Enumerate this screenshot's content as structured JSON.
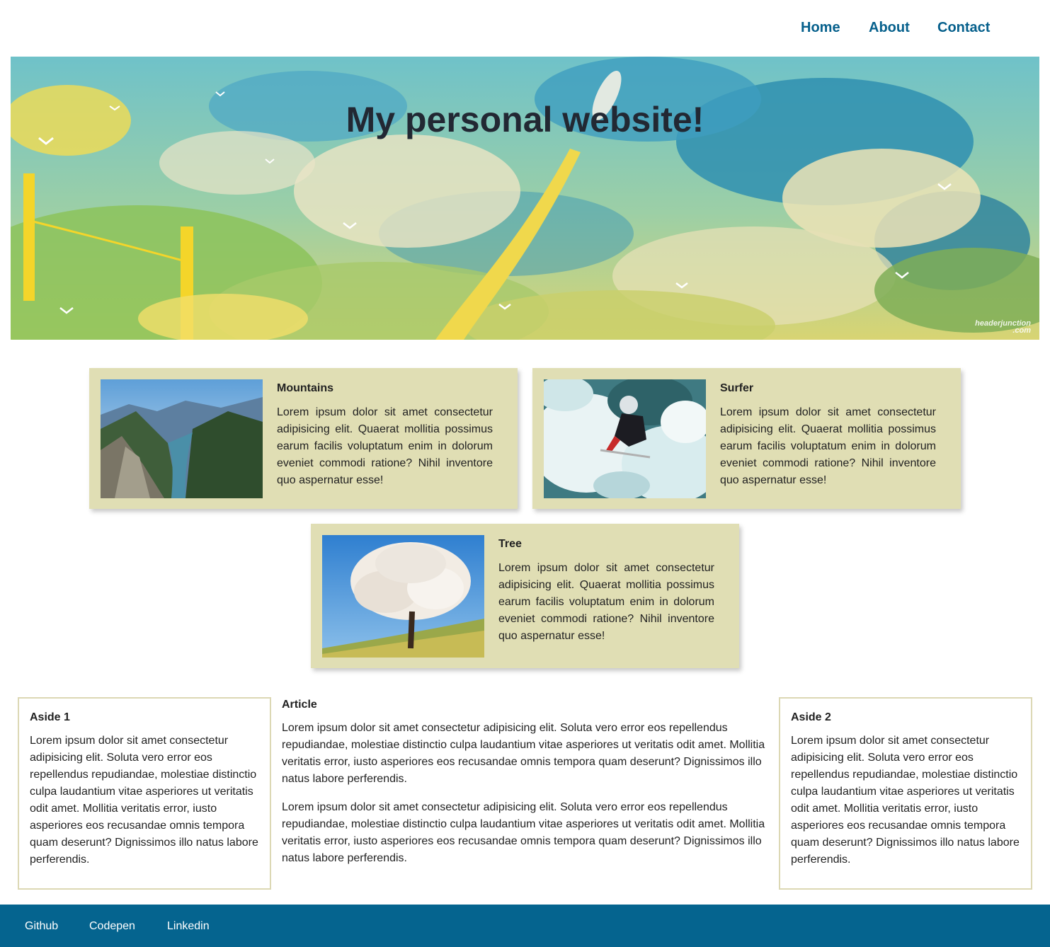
{
  "nav": {
    "home": "Home",
    "about": "About",
    "contact": "Contact"
  },
  "hero": {
    "title": "My personal website!",
    "watermark": "headerjunction .com"
  },
  "cards": [
    {
      "title": "Mountains",
      "text": "Lorem ipsum dolor sit amet consectetur adipisicing elit. Quaerat mollitia possimus earum facilis voluptatum enim in dolorum eveniet commodi ratione? Nihil inventore quo aspernatur esse!"
    },
    {
      "title": "Surfer",
      "text": "Lorem ipsum dolor sit amet consectetur adipisicing elit. Quaerat mollitia possimus earum facilis voluptatum enim in dolorum eveniet commodi ratione? Nihil inventore quo aspernatur esse!"
    },
    {
      "title": "Tree",
      "text": "Lorem ipsum dolor sit amet consectetur adipisicing elit. Quaerat mollitia possimus earum facilis voluptatum enim in dolorum eveniet commodi ratione? Nihil inventore quo aspernatur esse!"
    }
  ],
  "aside1": {
    "title": "Aside 1",
    "text": "Lorem ipsum dolor sit amet consectetur adipisicing elit. Soluta vero error eos repellendus repudiandae, molestiae distinctio culpa laudantium vitae asperiores ut veritatis odit amet. Mollitia veritatis error, iusto asperiores eos recusandae omnis tempora quam deserunt? Dignissimos illo natus labore perferendis."
  },
  "article": {
    "title": "Article",
    "paragraphs": [
      "Lorem ipsum dolor sit amet consectetur adipisicing elit. Soluta vero error eos repellendus repudiandae, molestiae distinctio culpa laudantium vitae asperiores ut veritatis odit amet. Mollitia veritatis error, iusto asperiores eos recusandae omnis tempora quam deserunt? Dignissimos illo natus labore perferendis.",
      "Lorem ipsum dolor sit amet consectetur adipisicing elit. Soluta vero error eos repellendus repudiandae, molestiae distinctio culpa laudantium vitae asperiores ut veritatis odit amet. Mollitia veritatis error, iusto asperiores eos recusandae omnis tempora quam deserunt? Dignissimos illo natus labore perferendis."
    ]
  },
  "aside2": {
    "title": "Aside 2",
    "text": "Lorem ipsum dolor sit amet consectetur adipisicing elit. Soluta vero error eos repellendus repudiandae, molestiae distinctio culpa laudantium vitae asperiores ut veritatis odit amet. Mollitia veritatis error, iusto asperiores eos recusandae omnis tempora quam deserunt? Dignissimos illo natus labore perferendis."
  },
  "footer": {
    "github": "Github",
    "codepen": "Codepen",
    "linkedin": "Linkedin"
  },
  "colors": {
    "nav_link": "#06608c",
    "card_bg": "#e0deb4",
    "aside_border": "#dcd8b4",
    "footer_bg": "#05648f"
  }
}
